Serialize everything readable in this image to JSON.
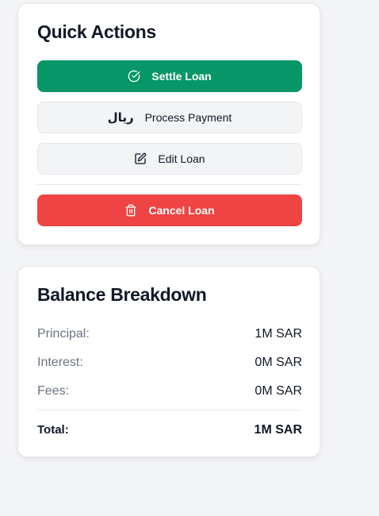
{
  "quick_actions": {
    "title": "Quick Actions",
    "settle_label": "Settle Loan",
    "payment_label": "Process Payment",
    "payment_icon_text": "ريال",
    "edit_label": "Edit Loan",
    "cancel_label": "Cancel Loan"
  },
  "balance": {
    "title": "Balance Breakdown",
    "rows": [
      {
        "label": "Principal:",
        "value": "1M SAR"
      },
      {
        "label": "Interest:",
        "value": "0M SAR"
      },
      {
        "label": "Fees:",
        "value": "0M SAR"
      }
    ],
    "total": {
      "label": "Total:",
      "value": "1M SAR"
    }
  },
  "colors": {
    "settle": "#069668",
    "cancel": "#ef4444",
    "background": "#f3f4f6"
  }
}
